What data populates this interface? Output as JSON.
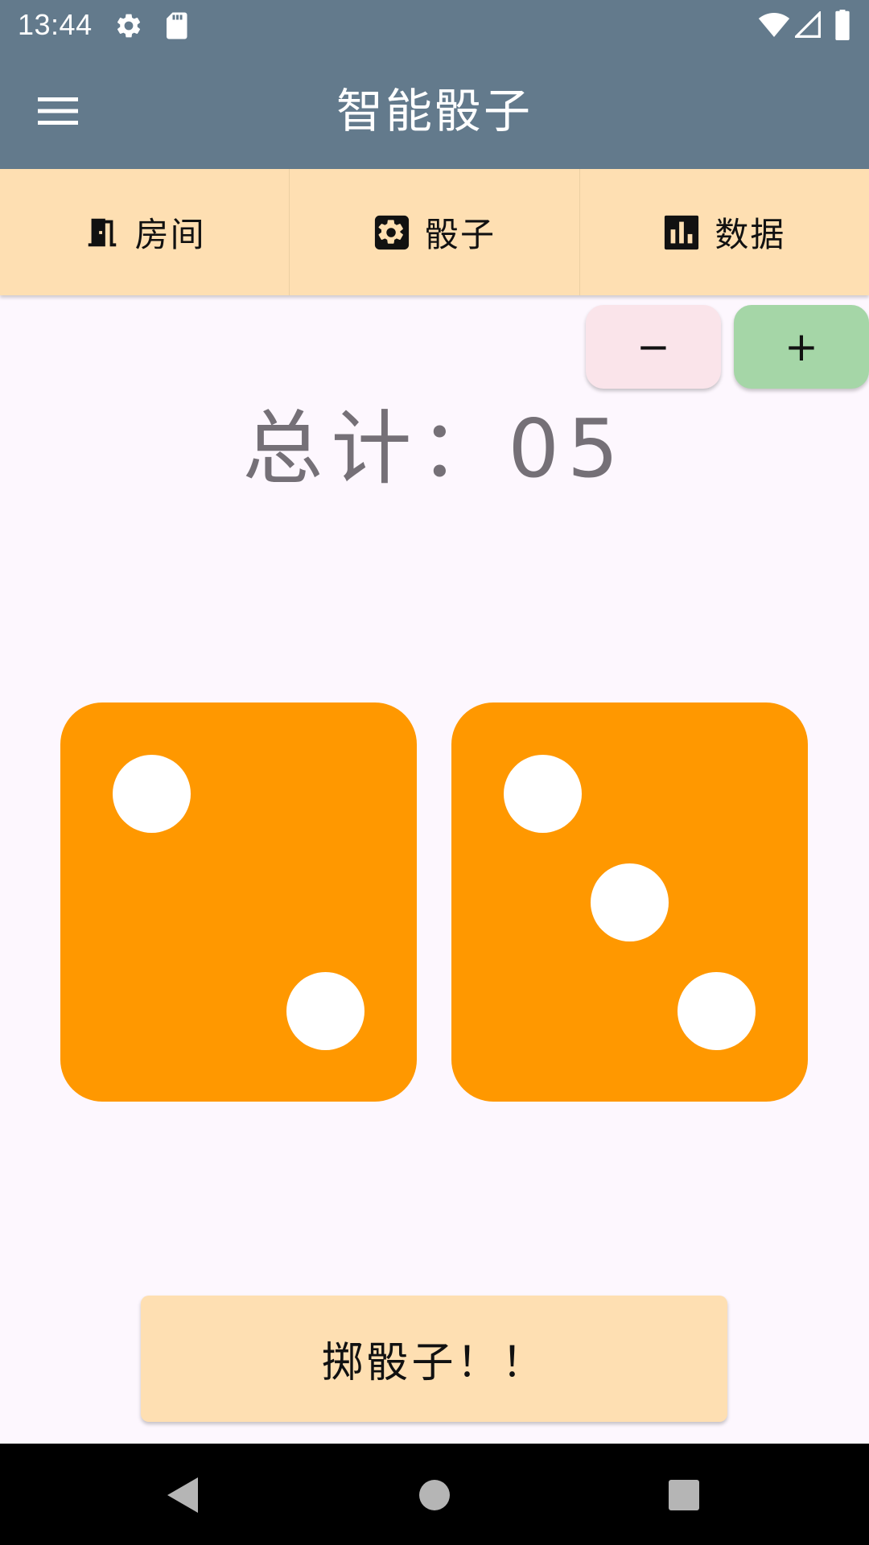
{
  "status_bar": {
    "time": "13:44",
    "icons": [
      "settings-icon",
      "sd-card-icon",
      "wifi-icon",
      "signal-icon",
      "battery-icon"
    ]
  },
  "app_bar": {
    "title": "智能骰子",
    "menu_icon": "hamburger-menu-icon"
  },
  "tabs": [
    {
      "label": "房间",
      "icon": "door-icon"
    },
    {
      "label": "骰子",
      "icon": "dice-icon"
    },
    {
      "label": "数据",
      "icon": "bar-chart-icon"
    }
  ],
  "stepper": {
    "minus_label": "−",
    "plus_label": "+"
  },
  "total_text": "总计：05",
  "dice": [
    {
      "value": 2,
      "color": "#ff9800"
    },
    {
      "value": 3,
      "color": "#ff9800"
    }
  ],
  "roll_button_label": "掷骰子！！",
  "colors": {
    "app_bar": "#637a8c",
    "tab_bar": "#fedfb2",
    "minus_button": "#fae4ea",
    "plus_button": "#a5d6a7",
    "die": "#ff9800",
    "background": "#fdf7fe"
  },
  "nav_bar": {
    "icons": [
      "back-icon",
      "home-icon",
      "recents-icon"
    ]
  }
}
